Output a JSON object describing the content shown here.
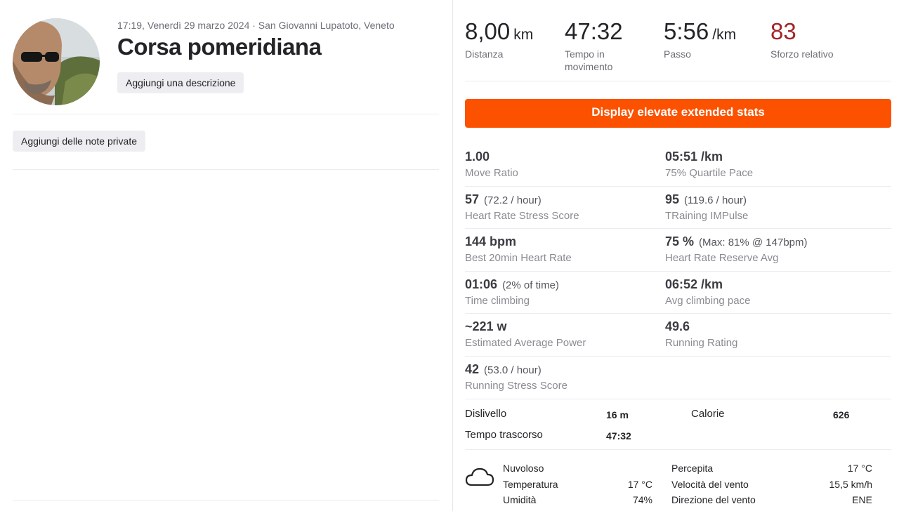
{
  "activity": {
    "meta": "17:19, Venerdì 29 marzo 2024 · San Giovanni Lupatoto, Veneto",
    "title": "Corsa pomeridiana",
    "add_description": "Aggiungi una descrizione",
    "add_private_notes": "Aggiungi delle note private"
  },
  "top_stats": [
    {
      "value": "8,00",
      "unit": "km",
      "label": "Distanza"
    },
    {
      "value": "47:32",
      "unit": "",
      "label": "Tempo in movimento"
    },
    {
      "value": "5:56",
      "unit": "/km",
      "label": "Passo"
    },
    {
      "value": "83",
      "unit": "",
      "label": "Sforzo relativo"
    }
  ],
  "elevate_button": "Display elevate extended stats",
  "extended": [
    {
      "value": "1.00",
      "sub": "",
      "label": "Move Ratio"
    },
    {
      "value": "05:51 /km",
      "sub": "",
      "label": "75% Quartile Pace"
    },
    {
      "value": "57",
      "sub": "(72.2 / hour)",
      "label": "Heart Rate Stress Score"
    },
    {
      "value": "95",
      "sub": "(119.6 / hour)",
      "label": "TRaining IMPulse"
    },
    {
      "value": "144 bpm",
      "sub": "",
      "label": "Best 20min Heart Rate"
    },
    {
      "value": "75 %",
      "sub": "(Max: 81% @ 147bpm)",
      "label": "Heart Rate Reserve Avg"
    },
    {
      "value": "01:06",
      "sub": "(2% of time)",
      "label": "Time climbing"
    },
    {
      "value": "06:52 /km",
      "sub": "",
      "label": "Avg climbing pace"
    },
    {
      "value": "~221 w",
      "sub": "",
      "label": "Estimated Average Power"
    },
    {
      "value": "49.6",
      "sub": "",
      "label": "Running Rating"
    },
    {
      "value": "42",
      "sub": "(53.0 / hour)",
      "label": "Running Stress Score"
    }
  ],
  "summary": {
    "dislivello_label": "Dislivello",
    "dislivello_value": "16 m",
    "calorie_label": "Calorie",
    "calorie_value": "626",
    "tempo_label": "Tempo trascorso",
    "tempo_value": "47:32"
  },
  "weather": {
    "icon": "cloud-icon",
    "condition": "Nuvoloso",
    "temperatura_label": "Temperatura",
    "temperatura_value": "17 °C",
    "umidita_label": "Umidità",
    "umidita_value": "74%",
    "percepita_label": "Percepita",
    "percepita_value": "17 °C",
    "vento_label": "Velocità del vento",
    "vento_value": "15,5 km/h",
    "direzione_label": "Direzione del vento",
    "direzione_value": "ENE"
  },
  "colors": {
    "accent": "#fc5200",
    "relative_effort": "#a32327"
  }
}
